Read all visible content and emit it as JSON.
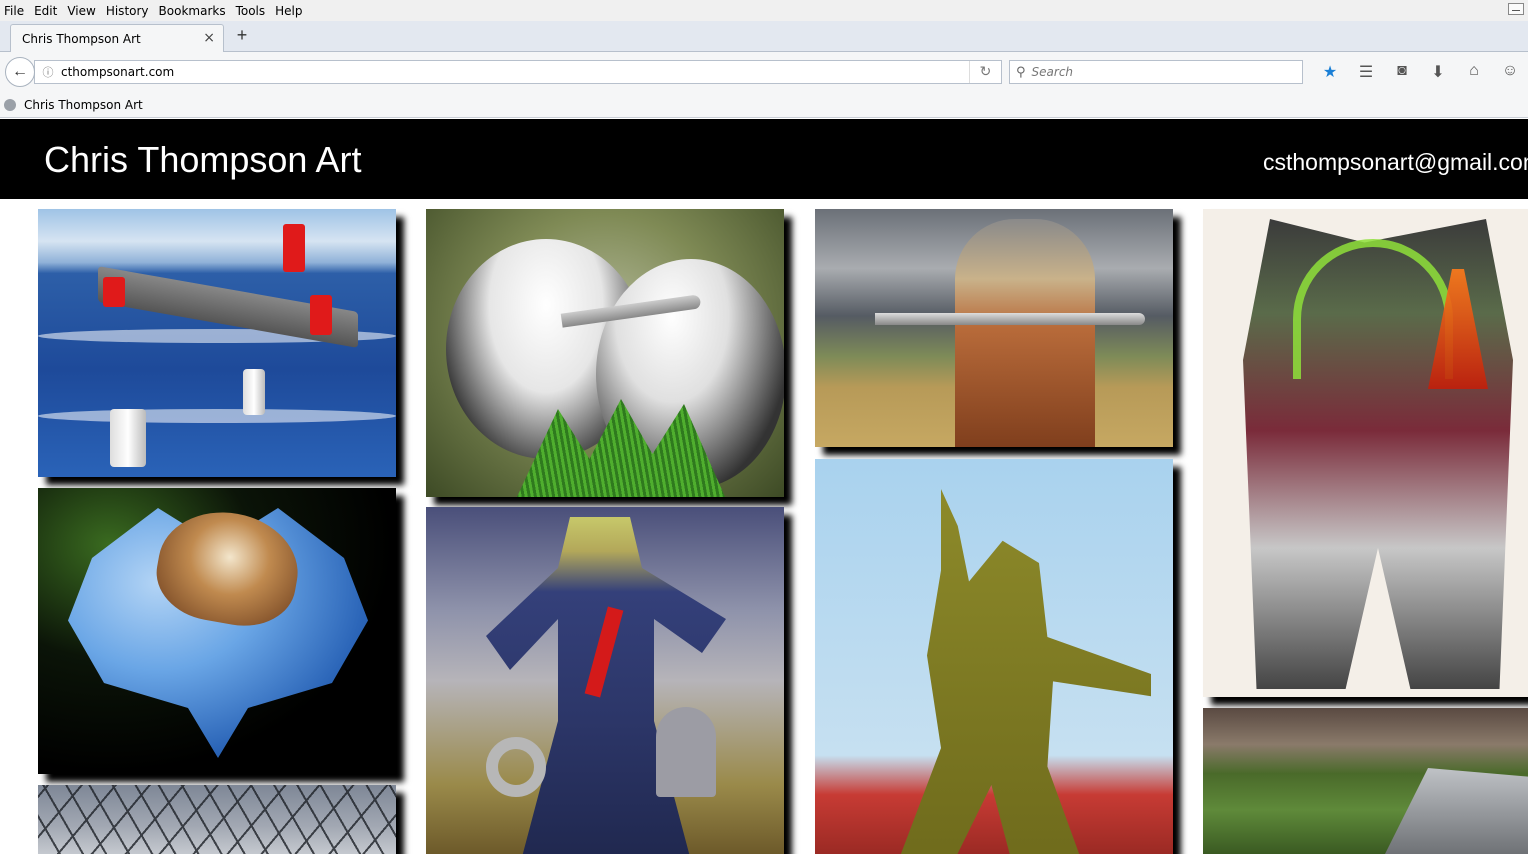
{
  "browser": {
    "menu": [
      "File",
      "Edit",
      "View",
      "History",
      "Bookmarks",
      "Tools",
      "Help"
    ],
    "tab_title": "Chris Thompson Art",
    "close_glyph": "×",
    "new_tab_glyph": "+",
    "back_glyph": "←",
    "info_glyph": "ⓘ",
    "url": "cthompsonart.com",
    "reload_glyph": "↻",
    "search_placeholder": "Search",
    "search_glyph": "⚲",
    "toolbar_icons": {
      "bookmark_star": "★",
      "reading_list": "☰",
      "pocket": "◙",
      "downloads": "⬇",
      "home": "⌂",
      "chat": "☺"
    },
    "bookmark_item": "Chris Thompson Art"
  },
  "page": {
    "title": "Chris Thompson Art",
    "email": "csthompsonart@gmail.com"
  },
  "colors": {
    "header_bg": "#000000",
    "header_text": "#ffffff",
    "accent_star": "#1a7fd6"
  }
}
